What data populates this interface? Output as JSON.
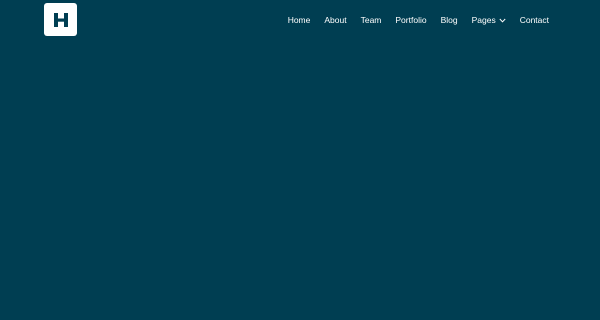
{
  "logo": {
    "glyph": "H",
    "background": "#ffffff",
    "color": "#003e52"
  },
  "nav": {
    "items": [
      {
        "label": "Home"
      },
      {
        "label": "About"
      },
      {
        "label": "Team"
      },
      {
        "label": "Portfolio"
      },
      {
        "label": "Blog"
      },
      {
        "label": "Pages",
        "icon": "chevron-down-icon"
      },
      {
        "label": "Contact"
      }
    ]
  },
  "colors": {
    "background": "#003e52",
    "nav_text": "#ffffff"
  }
}
